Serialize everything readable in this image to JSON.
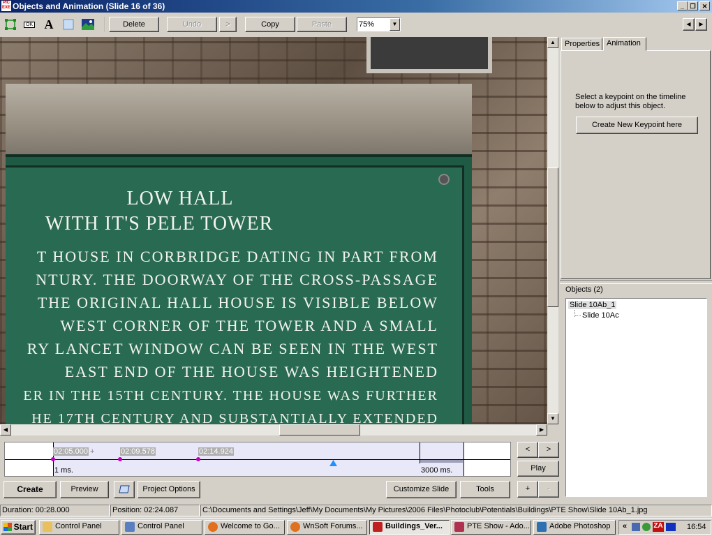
{
  "window": {
    "title": "Objects and Animation  (Slide 16 of 36)",
    "app_icon_text": "PIC EXE",
    "controls": {
      "minimize": "_",
      "maximize": "❒",
      "close": "✕"
    }
  },
  "toolbar": {
    "tools": [
      {
        "name": "frame-tool-icon"
      },
      {
        "name": "button-tool-icon",
        "text": "OK"
      },
      {
        "name": "text-tool-icon",
        "text": "A"
      },
      {
        "name": "rectangle-tool-icon"
      },
      {
        "name": "image-tool-icon"
      }
    ],
    "delete_label": "Delete",
    "undo_label": "Undo",
    "redo_label": ">",
    "copy_label": "Copy",
    "paste_label": "Paste",
    "zoom_value": "75%",
    "zoom_arrow": "▼",
    "prev_slide": "◀",
    "next_slide": "▶"
  },
  "canvas": {
    "sign_title_1": "LOW HALL",
    "sign_title_2": "WITH IT'S PELE TOWER",
    "sign_lines": [
      "T HOUSE IN CORBRIDGE DATING IN PART FROM",
      "NTURY. THE DOORWAY OF THE CROSS-PASSAGE",
      "THE ORIGINAL HALL HOUSE IS VISIBLE BELOW",
      "WEST CORNER OF THE TOWER AND A SMALL",
      "RY LANCET WINDOW CAN BE SEEN IN THE WEST",
      "EAST END OF THE HOUSE WAS HEIGHTENED",
      "ER IN THE 15TH CENTURY. THE HOUSE WAS FURTHER",
      "HE 17TH CENTURY AND SUBSTANTIALLY EXTENDED"
    ]
  },
  "right_panel": {
    "tabs": [
      "Properties",
      "Animation"
    ],
    "active_tab": "Animation",
    "instructions": "Select a keypoint on the timeline below to adjust this object.",
    "create_keypoint_label": "Create New Keypoint here",
    "objects_header": "Objects (2)",
    "objects": [
      "Slide 10Ab_1",
      "Slide 10Ac"
    ]
  },
  "timeline": {
    "keypoints": [
      "02:05.000",
      "02:09.578",
      "02:14.924"
    ],
    "plus": "+",
    "start_label": "1 ms.",
    "end_label": "3000 ms.",
    "nav_prev": "<",
    "nav_next": ">",
    "play_label": "Play",
    "plus_label": "+",
    "minus_label": "-"
  },
  "bottom_bar": {
    "create_label": "Create",
    "preview_label": "Preview",
    "project_options_label": "Project Options",
    "customize_slide_label": "Customize Slide",
    "tools_label": "Tools"
  },
  "status": {
    "duration": "Duration:  00:28.000",
    "position": "Position:  02:24.087",
    "path": "C:\\Documents and Settings\\Jeff\\My Documents\\My Pictures\\2006 Files\\Photoclub\\Potentials\\Buildings\\PTE Show\\Slide 10Ab_1.jpg"
  },
  "taskbar": {
    "start_label": "Start",
    "tasks": [
      {
        "label": "Control Panel",
        "icon_color": "#e8c060"
      },
      {
        "label": "Control Panel",
        "icon_color": "#5a7fc0"
      },
      {
        "label": "Welcome to Go...",
        "icon_color": "#e0701e"
      },
      {
        "label": "WnSoft Forums...",
        "icon_color": "#e0701e"
      },
      {
        "label": "Buildings_Ver...",
        "icon_color": "#c02020",
        "active": true
      },
      {
        "label": "PTE Show - Ado...",
        "icon_color": "#b03050"
      },
      {
        "label": "Adobe Photoshop",
        "icon_color": "#3070b0"
      }
    ],
    "tray_chevron": "«",
    "clock": "16:54"
  },
  "colors": {
    "titlebar_start": "#0a246a",
    "face": "#d4d0c8",
    "keypoint": "#c000c0",
    "timeline_fill": "#e8e8f8",
    "playhead": "#1e90ff"
  }
}
